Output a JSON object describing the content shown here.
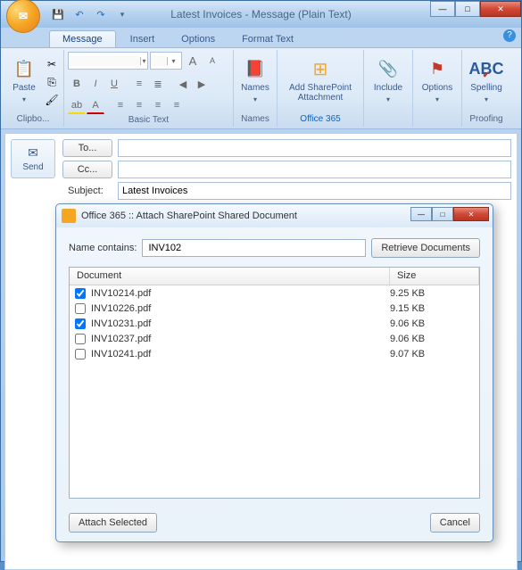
{
  "window": {
    "title": "Latest Invoices - Message (Plain Text)"
  },
  "qat": {
    "save": "💾",
    "undo": "↶",
    "redo": "↷",
    "dropdown": "▾"
  },
  "tabs": {
    "message": "Message",
    "insert": "Insert",
    "options": "Options",
    "format": "Format Text"
  },
  "ribbon": {
    "clipboard": {
      "paste": "Paste",
      "label": "Clipbo..."
    },
    "basictext": {
      "label": "Basic Text"
    },
    "names": {
      "label": "Names",
      "btn": "Names"
    },
    "office365": {
      "btn": "Add SharePoint Attachment",
      "label": "Office 365"
    },
    "include": {
      "btn": "Include",
      "label": ""
    },
    "options": {
      "btn": "Options",
      "label": ""
    },
    "proofing": {
      "btn": "Spelling",
      "label": "Proofing"
    }
  },
  "compose": {
    "send": "Send",
    "to": "To...",
    "cc": "Cc...",
    "subject_label": "Subject:",
    "subject_value": "Latest Invoices",
    "to_value": "",
    "cc_value": ""
  },
  "dialog": {
    "title": "Office 365 :: Attach SharePoint Shared Document",
    "name_contains_label": "Name contains:",
    "name_contains_value": "INV102",
    "retrieve": "Retrieve Documents",
    "header_doc": "Document",
    "header_size": "Size",
    "attach": "Attach Selected",
    "cancel": "Cancel",
    "rows": [
      {
        "checked": true,
        "name": "INV10214.pdf",
        "size": "9.25 KB"
      },
      {
        "checked": false,
        "name": "INV10226.pdf",
        "size": "9.15 KB"
      },
      {
        "checked": true,
        "name": "INV10231.pdf",
        "size": "9.06 KB"
      },
      {
        "checked": false,
        "name": "INV10237.pdf",
        "size": "9.06 KB"
      },
      {
        "checked": false,
        "name": "INV10241.pdf",
        "size": "9.07 KB"
      }
    ]
  }
}
